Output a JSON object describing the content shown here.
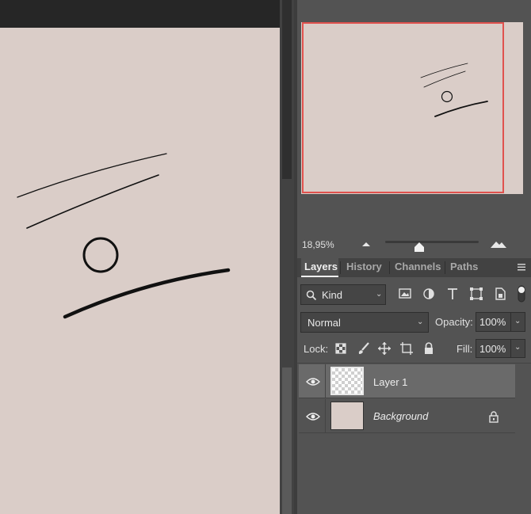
{
  "navigator": {
    "zoom": "18,95%",
    "view_color": "#e0524e"
  },
  "tabs": [
    {
      "label": "Layers",
      "active": true
    },
    {
      "label": "History",
      "active": false
    },
    {
      "label": "Channels",
      "active": false
    },
    {
      "label": "Paths",
      "active": false
    }
  ],
  "layers_panel": {
    "filter": {
      "label": "Kind"
    },
    "blend_mode": "Normal",
    "opacity_label": "Opacity:",
    "opacity_value": "100%",
    "lock_label": "Lock:",
    "fill_label": "Fill:",
    "fill_value": "100%",
    "layers": [
      {
        "name": "Layer 1",
        "selected": true,
        "visible": true,
        "transparent": true,
        "locked": false
      },
      {
        "name": "Background",
        "selected": false,
        "visible": true,
        "transparent": false,
        "locked": true
      }
    ]
  },
  "colors": {
    "canvas": "#dacdc8",
    "panel": "#535353",
    "selected_row": "#6a6a6a"
  },
  "icons": {
    "filter": [
      "search-icon",
      "image-filter-icon",
      "adjustment-filter-icon",
      "type-filter-icon",
      "shape-filter-icon",
      "smart-object-filter-icon"
    ],
    "lock": [
      "lock-transparent-pixels-icon",
      "lock-image-pixels-icon",
      "lock-position-icon",
      "lock-artboard-icon",
      "lock-all-icon"
    ]
  }
}
